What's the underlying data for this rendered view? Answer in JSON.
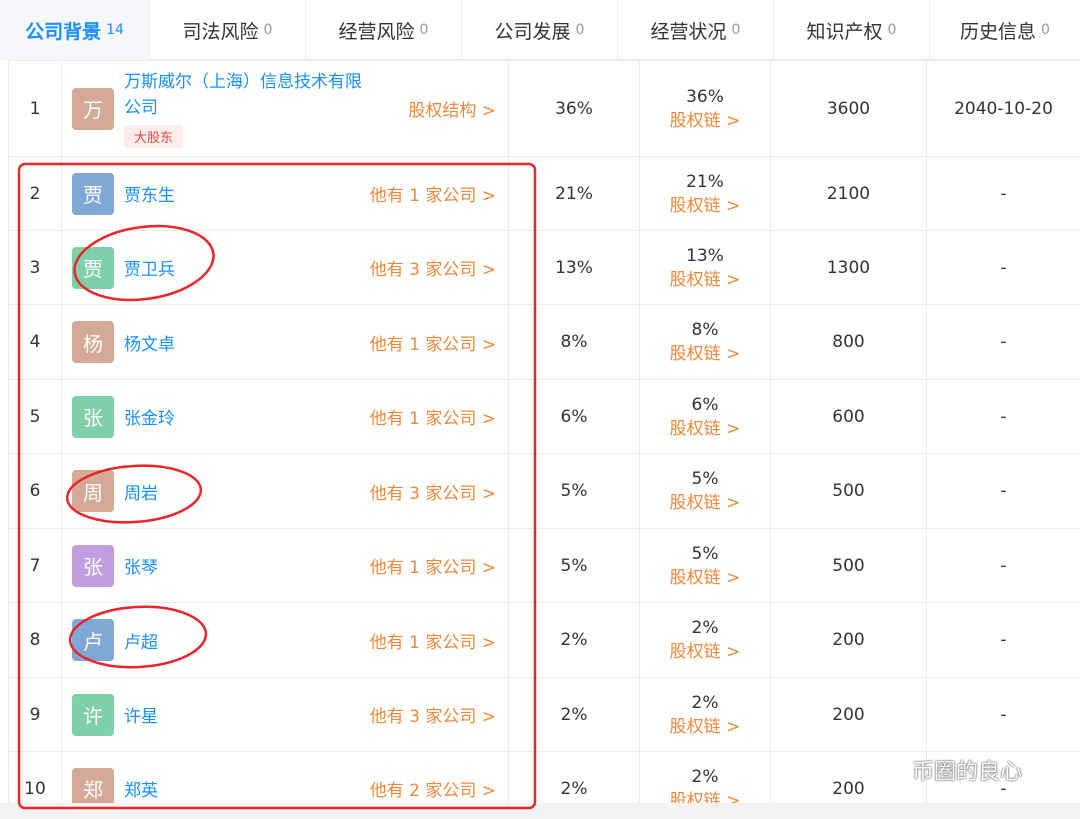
{
  "tabs": [
    {
      "label": "公司背景",
      "count": "14"
    },
    {
      "label": "司法风险",
      "count": "0"
    },
    {
      "label": "经营风险",
      "count": "0"
    },
    {
      "label": "公司发展",
      "count": "0"
    },
    {
      "label": "经营状况",
      "count": "0"
    },
    {
      "label": "知识产权",
      "count": "0"
    },
    {
      "label": "历史信息",
      "count": "0"
    }
  ],
  "colors": {
    "link_blue": "#1890ff",
    "link_orange": "#f0883a",
    "annotation_red": "#e8262c",
    "badge_bg": "#fdecec"
  },
  "rows": [
    {
      "num": "1",
      "avatar": "万",
      "avatar_color": "#d4a995",
      "name": "万斯威尔（上海）信息技术有限公司",
      "badge": "大股东",
      "link": "股权结构 >",
      "ratio": "36%",
      "chain_ratio": "36%",
      "chain_link": "股权链 >",
      "amount": "3600",
      "date": "2040-10-20"
    },
    {
      "num": "2",
      "avatar": "贾",
      "avatar_color": "#7fa8d6",
      "name": "贾东生",
      "link": "他有 1 家公司 >",
      "ratio": "21%",
      "chain_ratio": "21%",
      "chain_link": "股权链 >",
      "amount": "2100",
      "date": "-"
    },
    {
      "num": "3",
      "avatar": "贾",
      "avatar_color": "#7fcfa9",
      "name": "贾卫兵",
      "link": "他有 3 家公司 >",
      "ratio": "13%",
      "chain_ratio": "13%",
      "chain_link": "股权链 >",
      "amount": "1300",
      "date": "-"
    },
    {
      "num": "4",
      "avatar": "杨",
      "avatar_color": "#d4a995",
      "name": "杨文卓",
      "link": "他有 1 家公司 >",
      "ratio": "8%",
      "chain_ratio": "8%",
      "chain_link": "股权链 >",
      "amount": "800",
      "date": "-"
    },
    {
      "num": "5",
      "avatar": "张",
      "avatar_color": "#7fcfa9",
      "name": "张金玲",
      "link": "他有 1 家公司 >",
      "ratio": "6%",
      "chain_ratio": "6%",
      "chain_link": "股权链 >",
      "amount": "600",
      "date": "-"
    },
    {
      "num": "6",
      "avatar": "周",
      "avatar_color": "#d4a995",
      "name": "周岩",
      "link": "他有 3 家公司 >",
      "ratio": "5%",
      "chain_ratio": "5%",
      "chain_link": "股权链 >",
      "amount": "500",
      "date": "-"
    },
    {
      "num": "7",
      "avatar": "张",
      "avatar_color": "#c09ee0",
      "name": "张琴",
      "link": "他有 1 家公司 >",
      "ratio": "5%",
      "chain_ratio": "5%",
      "chain_link": "股权链 >",
      "amount": "500",
      "date": "-"
    },
    {
      "num": "8",
      "avatar": "卢",
      "avatar_color": "#7fa8d6",
      "name": "卢超",
      "link": "他有 1 家公司 >",
      "ratio": "2%",
      "chain_ratio": "2%",
      "chain_link": "股权链 >",
      "amount": "200",
      "date": "-"
    },
    {
      "num": "9",
      "avatar": "许",
      "avatar_color": "#7fcfa9",
      "name": "许星",
      "link": "他有 3 家公司 >",
      "ratio": "2%",
      "chain_ratio": "2%",
      "chain_link": "股权链 >",
      "amount": "200",
      "date": "-"
    },
    {
      "num": "10",
      "avatar": "郑",
      "avatar_color": "#d4a995",
      "name": "郑英",
      "link": "他有 2 家公司 >",
      "ratio": "2%",
      "chain_ratio": "2%",
      "chain_link": "股权链 >",
      "amount": "200",
      "date": "-"
    }
  ],
  "watermark": {
    "text": "币圈的良心",
    "icon": "wechat-icon"
  }
}
